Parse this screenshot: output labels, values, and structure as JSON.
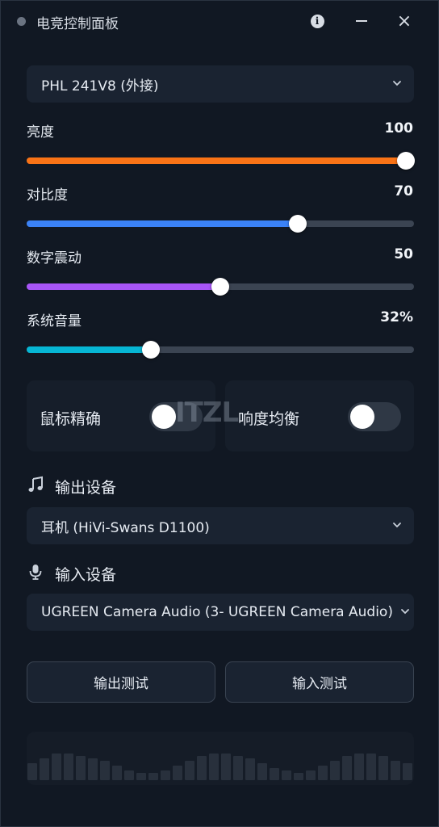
{
  "window": {
    "title": "电竞控制面板"
  },
  "monitor_select": {
    "value": "PHL 241V8 (外接)"
  },
  "sliders": [
    {
      "label": "亮度",
      "value_text": "100",
      "value": 100,
      "color": "#f97316"
    },
    {
      "label": "对比度",
      "value_text": "70",
      "value": 70,
      "color": "#3b82f6"
    },
    {
      "label": "数字震动",
      "value_text": "50",
      "value": 50,
      "color": "#a855f7"
    },
    {
      "label": "系统音量",
      "value_text": "32%",
      "value": 32,
      "color": "#06b6d4"
    }
  ],
  "toggles": [
    {
      "label": "鼠标精确",
      "on": false
    },
    {
      "label": "响度均衡",
      "on": false
    }
  ],
  "watermark": "ITZL",
  "output": {
    "title": "输出设备",
    "icon": "music-note-icon",
    "value": "耳机 (HiVi-Swans D1100)"
  },
  "input": {
    "title": "输入设备",
    "icon": "microphone-icon",
    "value": "UGREEN Camera Audio (3- UGREEN Camera Audio)"
  },
  "buttons": {
    "output_test": "输出测试",
    "input_test": "输入测试"
  },
  "visualizer": {
    "levels": [
      0.35,
      0.45,
      0.55,
      0.55,
      0.5,
      0.45,
      0.4,
      0.3,
      0.2,
      0.15,
      0.15,
      0.2,
      0.3,
      0.4,
      0.5,
      0.55,
      0.55,
      0.5,
      0.45,
      0.35,
      0.25,
      0.2,
      0.15,
      0.2,
      0.3,
      0.4,
      0.5,
      0.55,
      0.55,
      0.5,
      0.4,
      0.35
    ]
  }
}
